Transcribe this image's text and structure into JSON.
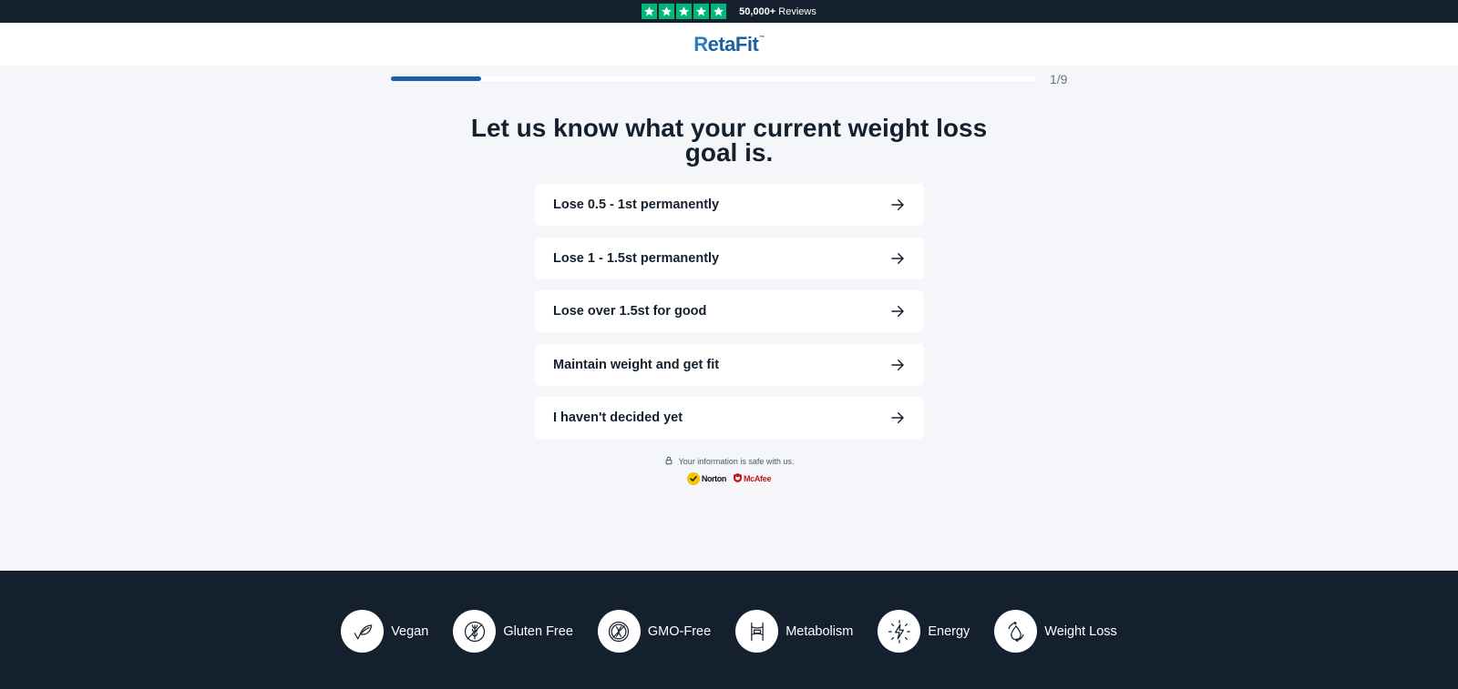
{
  "topbar": {
    "rating_stars": 5,
    "reviews_count": "50,000+",
    "reviews_label": "Reviews",
    "star_color": "#00b67a"
  },
  "header": {
    "logo_mark": "R",
    "logo_rest": "etaFit",
    "logo_tm": "™"
  },
  "progress": {
    "fraction": 0.14,
    "step_label": "1/9"
  },
  "question": {
    "title": "Let us know what your current weight loss goal is."
  },
  "options": [
    {
      "label": "Lose 0.5 - 1st permanently",
      "icon": "arrow-right-icon"
    },
    {
      "label": "Lose 1 - 1.5st permanently",
      "icon": "arrow-right-icon"
    },
    {
      "label": "Lose over 1.5st for good",
      "icon": "arrow-right-icon"
    },
    {
      "label": "Maintain weight and get fit",
      "icon": "arrow-right-icon"
    },
    {
      "label": "I haven't decided yet",
      "icon": "arrow-right-icon"
    }
  ],
  "security": {
    "text": "Your information is safe with us.",
    "norton": "Norton",
    "mcafee": "McAfee"
  },
  "footer": {
    "features": [
      {
        "label": "Vegan",
        "icon": "leaf-icon"
      },
      {
        "label": "Gluten Free",
        "icon": "gluten-free-icon"
      },
      {
        "label": "GMO-Free",
        "icon": "gmo-free-icon"
      },
      {
        "label": "Metabolism",
        "icon": "metabolism-icon"
      },
      {
        "label": "Energy",
        "icon": "energy-icon"
      },
      {
        "label": "Weight Loss",
        "icon": "weight-loss-icon"
      }
    ]
  },
  "colors": {
    "brand": "#1d5fa3",
    "dark": "#14202e",
    "background": "#f4f6fa"
  }
}
